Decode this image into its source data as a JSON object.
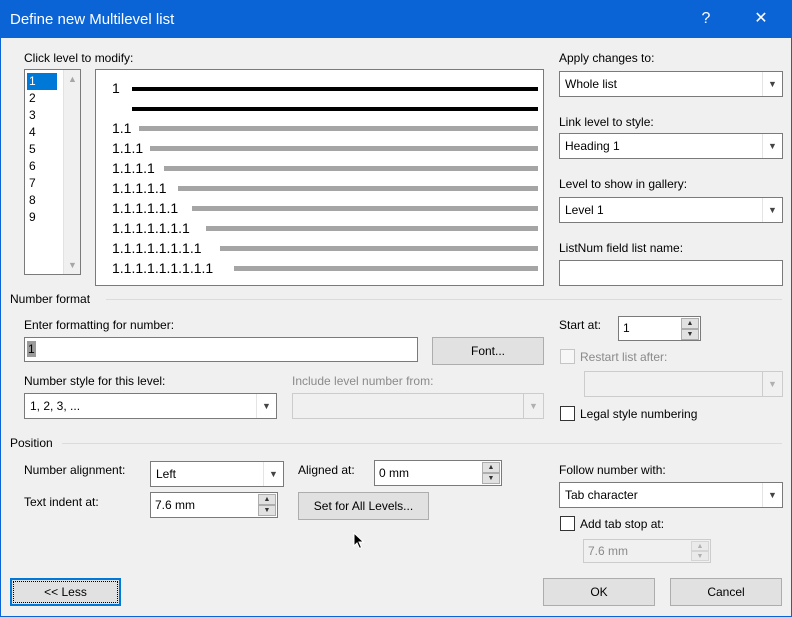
{
  "window": {
    "title": "Define new Multilevel list",
    "help_glyph": "?",
    "close_glyph": "✕"
  },
  "levels": {
    "label": "Click level to modify:",
    "items": [
      "1",
      "2",
      "3",
      "4",
      "5",
      "6",
      "7",
      "8",
      "9"
    ],
    "selected": "1"
  },
  "preview": {
    "rows": [
      "1",
      "1.1",
      "1.1.1",
      "1.1.1.1",
      "1.1.1.1.1",
      "1.1.1.1.1.1",
      "1.1.1.1.1.1.1",
      "1.1.1.1.1.1.1.1",
      "1.1.1.1.1.1.1.1.1"
    ]
  },
  "apply": {
    "label": "Apply changes to:",
    "value": "Whole list"
  },
  "link": {
    "label": "Link level to style:",
    "value": "Heading 1"
  },
  "gallery": {
    "label": "Level to show in gallery:",
    "value": "Level 1"
  },
  "listnum": {
    "label": "ListNum field list name:",
    "value": ""
  },
  "number_format": {
    "section": "Number format",
    "enter_label": "Enter formatting for number:",
    "enter_value": "1",
    "font_button": "Font...",
    "style_label": "Number style for this level:",
    "style_value": "1, 2, 3, ...",
    "include_label": "Include level number from:",
    "include_value": "",
    "start_label": "Start at:",
    "start_value": "1",
    "restart_label": "Restart list after:",
    "restart_value": "",
    "legal_label": "Legal style numbering"
  },
  "position": {
    "section": "Position",
    "alignment_label": "Number alignment:",
    "alignment_value": "Left",
    "aligned_label": "Aligned at:",
    "aligned_value": "0 mm",
    "indent_label": "Text indent at:",
    "indent_value": "7.6 mm",
    "set_all_button": "Set for All Levels...",
    "follow_label": "Follow number with:",
    "follow_value": "Tab character",
    "tab_stop_label": "Add tab stop at:",
    "tab_stop_value": "7.6 mm"
  },
  "footer": {
    "less_button": "<< Less",
    "ok_button": "OK",
    "cancel_button": "Cancel"
  }
}
